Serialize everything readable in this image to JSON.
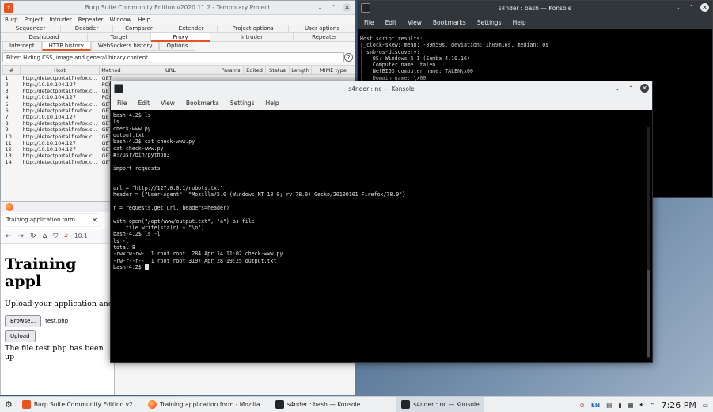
{
  "burp": {
    "title": "Burp Suite Community Edition v2020.11.2 - Temporary Project",
    "menu": [
      "Burp",
      "Project",
      "Intruder",
      "Repeater",
      "Window",
      "Help"
    ],
    "tabs_row1": [
      "Sequencer",
      "Decoder",
      "Comparer",
      "Extender",
      "Project options",
      "User options"
    ],
    "tabs_row2": [
      "Dashboard",
      "Target",
      "Proxy",
      "Intruder",
      "Repeater"
    ],
    "subtabs": [
      "Intercept",
      "HTTP history",
      "WebSockets history",
      "Options"
    ],
    "filter": "Filter: Hiding CSS, image and general binary content",
    "columns": [
      "#",
      "Host",
      "Method",
      "URL",
      "Params",
      "Edited",
      "Status",
      "Length",
      "MIME type"
    ],
    "rows": [
      [
        "1",
        "http://detectportal.firefox.c...",
        "GET"
      ],
      [
        "2",
        "http://10.10.104.127",
        "POS"
      ],
      [
        "3",
        "http://detectportal.firefox.c...",
        "GET"
      ],
      [
        "4",
        "http://10.10.104.127",
        "POS"
      ],
      [
        "5",
        "http://detectportal.firefox.c...",
        "GET"
      ],
      [
        "6",
        "http://detectportal.firefox.c...",
        "GET"
      ],
      [
        "7",
        "http://10.10.104.127",
        "GET"
      ],
      [
        "8",
        "http://detectportal.firefox.c...",
        "GET"
      ],
      [
        "9",
        "http://detectportal.firefox.c...",
        "GET"
      ],
      [
        "10",
        "http://detectportal.firefox.c...",
        "GET"
      ],
      [
        "11",
        "http://10.10.104.127",
        "GET"
      ],
      [
        "12",
        "http://10.10.104.127",
        "GET"
      ],
      [
        "13",
        "http://detectportal.firefox.c...",
        "GET"
      ],
      [
        "14",
        "http://detectportal.firefox.c...",
        "GET"
      ]
    ]
  },
  "konsole_bash": {
    "title": "s4nder : bash — Konsole",
    "menu": [
      "File",
      "Edit",
      "View",
      "Bookmarks",
      "Settings",
      "Help"
    ],
    "lines": [
      "Host script results:",
      "|_clock-skew: mean: -39m59s, deviation: 1h09m16s, median: 0s",
      "| smb-os-discovery:",
      "|   OS: Windows 6.1 (Samba 4.10.16)",
      "|   Computer name: talen",
      "|   NetBIOS computer name: TALEN\\x00",
      "|   Domain name: \\x00"
    ]
  },
  "browser": {
    "tab_title": "Training application form",
    "url": "10.1",
    "heading": "Training appl",
    "instruction": "Upload your application and",
    "browse_label": "Browse...",
    "file_name": "test.php",
    "upload_label": "Upload",
    "result": "The file test.php has been up"
  },
  "konsole_nc": {
    "title": "s4nder : nc — Konsole",
    "menu": [
      "File",
      "Edit",
      "View",
      "Bookmarks",
      "Settings",
      "Help"
    ],
    "lines": [
      "bash-4.2$ ls",
      "ls",
      "check-www.py",
      "output.txt",
      "bash-4.2$ cat check-www.py",
      "cat check-www.py",
      "#!/usr/bin/python3",
      "",
      "import requests",
      "",
      "",
      "url = \"http://127.0.0.1/robots.txt\"",
      "header = {\"User-Agent\": \"Mozilla/5.0 (Windows NT 10.0; rv:78.0) Gecko/20100101 Firefox/78.0\"}",
      "",
      "r = requests.get(url, headers=header)",
      "",
      "with open(\"/opt/www/output.txt\", \"a\") as file:",
      "    file.write(str(r) + \"\\n\")",
      "bash-4.2$ ls -l",
      "ls -l",
      "total 8",
      "-rwxrw-rw-. 1 root root  284 Apr 14 11:02 check-www.py",
      "-rw-r--r--. 1 root root 3197 Apr 28 19:25 output.txt"
    ],
    "prompt": "bash-4.2$ "
  },
  "taskbar": {
    "items": [
      "Burp Suite Community Edition v2...",
      "Training application form - Mozilla...",
      "s4nder : bash — Konsole",
      "s4nder : nc — Konsole"
    ],
    "lang": "EN",
    "clock": "7:26 PM"
  },
  "colors": {
    "burp_orange": "#e8541f",
    "konsole_dark": "#31363b",
    "terminal_bg": "#000000"
  }
}
